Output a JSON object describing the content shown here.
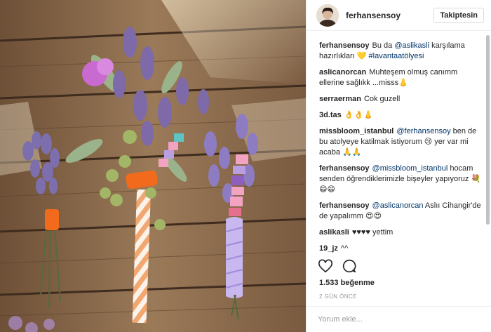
{
  "post": {
    "username": "ferhansensoy",
    "follow_label": "Takiptesin",
    "likes": "1.533 beğenme",
    "date": "2 GÜN ÖNCE",
    "comment_placeholder": "Yorum ekle..."
  },
  "comments": [
    {
      "user": "ferhansensoy",
      "parts": [
        {
          "text": "Bu da ",
          "kind": "plain"
        },
        {
          "text": "@aslikasli",
          "kind": "mention"
        },
        {
          "text": " karşılama hazırlıkları 💛 ",
          "kind": "plain"
        },
        {
          "text": "#lavantaatölyesi",
          "kind": "tag"
        }
      ]
    },
    {
      "user": "aslicanorcan",
      "parts": [
        {
          "text": "Muhteşem olmuş canımm ellerine sağlıkk ...misss👃",
          "kind": "plain"
        }
      ]
    },
    {
      "user": "serraerman",
      "parts": [
        {
          "text": "Cok guzell",
          "kind": "plain"
        }
      ]
    },
    {
      "user": "3d.tas",
      "parts": [
        {
          "text": "👌👌👃",
          "kind": "plain"
        }
      ]
    },
    {
      "user": "missbloom_istanbul",
      "parts": [
        {
          "text": "@ferhansensoy",
          "kind": "mention"
        },
        {
          "text": " ben de bu atolyeye katilmak istiyorum 😢 yer var mi acaba 🙏🙏",
          "kind": "plain"
        }
      ]
    },
    {
      "user": "ferhansensoy",
      "parts": [
        {
          "text": "@missbloom_istanbul",
          "kind": "mention"
        },
        {
          "text": " hocam senden öğrendiklerimizle bişeyler yapıyoruz 💐😄😄",
          "kind": "plain"
        }
      ]
    },
    {
      "user": "ferhansensoy",
      "parts": [
        {
          "text": "@aslicanorcan",
          "kind": "mention"
        },
        {
          "text": " Aslıı Cihangir'de de yapalımm 😍😍",
          "kind": "plain"
        }
      ]
    },
    {
      "user": "aslikasli",
      "parts": [
        {
          "text": "♥♥♥♥ yettim",
          "kind": "plain"
        }
      ]
    },
    {
      "user": "19_jz",
      "parts": [
        {
          "text": "^^",
          "kind": "plain"
        }
      ]
    },
    {
      "user": "19_jz",
      "parts": [
        {
          "text": "♥",
          "kind": "plain"
        }
      ]
    }
  ],
  "icons": {
    "like": "heart-icon",
    "comment": "speech-bubble-icon"
  },
  "colors": {
    "mention": "#003569",
    "wood": "#8a6a4a",
    "lavender": "#8e7cc3"
  }
}
